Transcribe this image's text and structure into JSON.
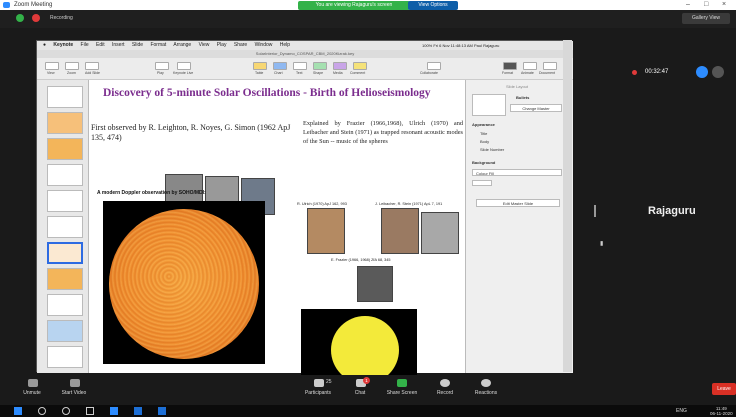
{
  "zoom": {
    "window_title": "Zoom Meeting",
    "share_banner": "You are viewing Rajaguru's screen",
    "view_options": "View Options",
    "recording_label": "Recording",
    "gallery_view": "Gallery View",
    "timer": "00:32:47",
    "participant_name": "Rajaguru",
    "bottom_buttons": [
      "Unmute",
      "Start Video",
      "Participants",
      "Chat",
      "Share Screen",
      "Record",
      "Reactions"
    ],
    "participant_count": "25",
    "chat_badge": "1",
    "leave": "Leave"
  },
  "keynote": {
    "menu": [
      "Keynote",
      "File",
      "Edit",
      "Insert",
      "Slide",
      "Format",
      "Arrange",
      "View",
      "Play",
      "Share",
      "Window",
      "Help"
    ],
    "menu_status": "100%  Fri 6 Nov  11:48:13 AM  Paul Rajaguru",
    "doc_title": "SolarInterior_Dynamo_COSPAR_CBM_2020Kizrak.key",
    "toolbar_left": [
      "View",
      "Zoom",
      "Add Slide"
    ],
    "toolbar_mid": [
      "Play",
      "Keynote Live",
      "Table",
      "Chart",
      "Text",
      "Shape",
      "Media",
      "Comment",
      "Collaborate"
    ],
    "toolbar_right": [
      "Format",
      "Animate",
      "Document"
    ],
    "inspector": {
      "header": "Slide Layout",
      "bullets": "Bullets",
      "change_master": "Change Master",
      "appearance": "Appearance",
      "options": [
        "Title",
        "Body",
        "Slide Number"
      ],
      "background": "Background",
      "colour_fill": "Colour Fill",
      "edit_master": "Edit Master Slide"
    }
  },
  "slide": {
    "title": "Discovery of 5-minute Solar Oscillations  - Birth of Helioseismology",
    "left_text": "First observed by R. Leighton, R. Noyes, G. Simon (1962 ApJ 135, 474)",
    "right_text": "Explained by Frazier (1966,1968), Ulrich (1970) and Leibacher and Stein (1971) as trapped resonant acoustic modes of the Sun -- music of the spheres",
    "caption_ulrich": "R. Ulrich (1970) ApJ 162, 993",
    "caption_leibacher": "J. Leibacher, R. Stein (1971) ApL 7, 191",
    "caption_frazier": "E. Frazier (1966, 1968) ZfA 68, 345",
    "doppler_label": "A modern Doppler observation by SOHO/MDI:"
  },
  "taskbar": {
    "lang": "ENG",
    "time": "11:49",
    "date": "06-11-2020"
  },
  "colors": {
    "title_purple": "#7b2d8e",
    "share_green": "#33b249",
    "leave_red": "#d93025",
    "sun_yellow": "#f3ea3a",
    "sun_orange": "#f08a2a"
  }
}
